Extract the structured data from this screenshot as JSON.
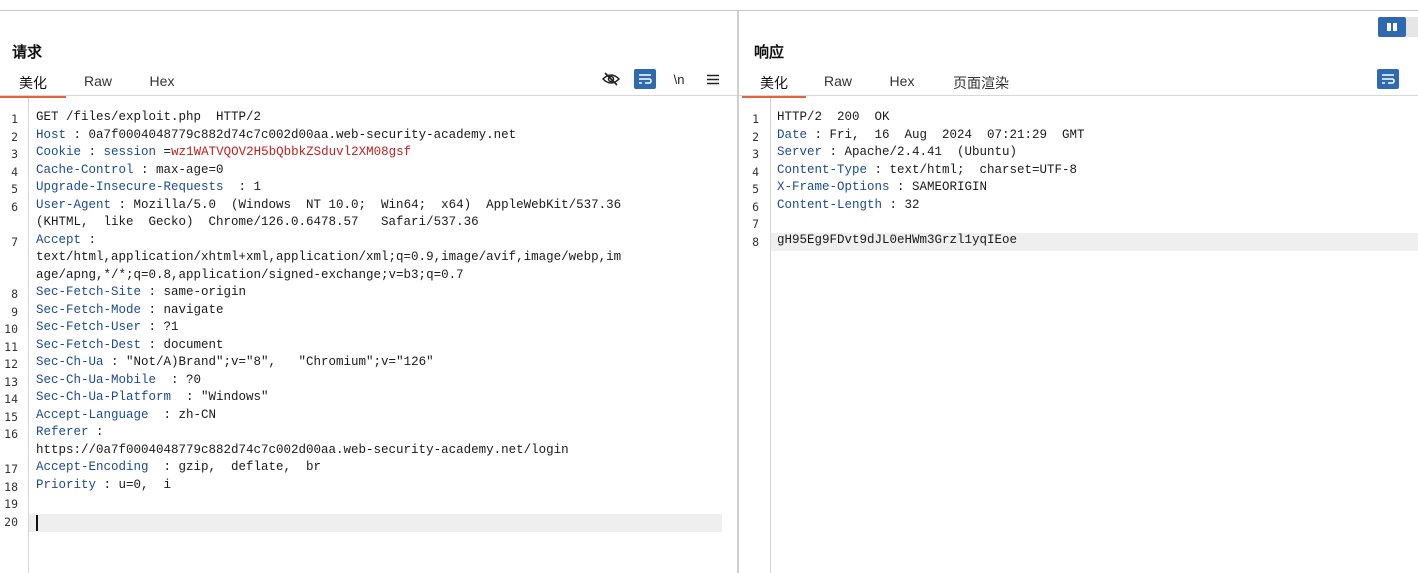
{
  "request": {
    "title": "请求",
    "tabs": [
      {
        "label": "美化",
        "active": true
      },
      {
        "label": "Raw",
        "active": false
      },
      {
        "label": "Hex",
        "active": false
      }
    ],
    "tools": {
      "hide": "eye-off-icon",
      "wrap": "wrap-icon",
      "newline": "\\n",
      "menu": "menu-icon"
    },
    "lines": [
      {
        "no": "1",
        "parts": [
          {
            "t": "GET /files/exploit.php  HTTP/2",
            "c": "v"
          }
        ]
      },
      {
        "no": "2",
        "parts": [
          {
            "t": "Host",
            "c": "k"
          },
          {
            "t": " : 0a7f0004048779c882d74c7c002d00aa.web-security-academy.net",
            "c": "v"
          }
        ]
      },
      {
        "no": "3",
        "parts": [
          {
            "t": "Cookie",
            "c": "k"
          },
          {
            "t": " : ",
            "c": "v"
          },
          {
            "t": "session",
            "c": "k"
          },
          {
            "t": " =",
            "c": "v"
          },
          {
            "t": "wz1WATVQOV2H5bQbbkZSduvl2XM08gsf",
            "c": "red"
          }
        ]
      },
      {
        "no": "4",
        "parts": [
          {
            "t": "Cache-Control",
            "c": "k"
          },
          {
            "t": " : max-age=0",
            "c": "v"
          }
        ]
      },
      {
        "no": "5",
        "parts": [
          {
            "t": "Upgrade-Insecure-Requests",
            "c": "k"
          },
          {
            "t": "  : 1",
            "c": "v"
          }
        ]
      },
      {
        "no": "6",
        "parts": [
          {
            "t": "User-Agent",
            "c": "k"
          },
          {
            "t": " : Mozilla/5.0  (Windows  NT 10.0;  Win64;  x64)  AppleWebKit/537.36",
            "c": "v"
          }
        ]
      },
      {
        "no": "",
        "parts": [
          {
            "t": "(KHTML,  like  Gecko)  Chrome/126.0.6478.57   Safari/537.36",
            "c": "v"
          }
        ]
      },
      {
        "no": "7",
        "parts": [
          {
            "t": "Accept",
            "c": "k"
          },
          {
            "t": " :",
            "c": "v"
          }
        ]
      },
      {
        "no": "",
        "parts": [
          {
            "t": "text/html,application/xhtml+xml,application/xml;q=0.9,image/avif,image/webp,im",
            "c": "v"
          }
        ]
      },
      {
        "no": "",
        "parts": [
          {
            "t": "age/apng,*/*;q=0.8,application/signed-exchange;v=b3;q=0.7",
            "c": "v"
          }
        ]
      },
      {
        "no": "8",
        "parts": [
          {
            "t": "Sec-Fetch-Site",
            "c": "k"
          },
          {
            "t": " : same-origin",
            "c": "v"
          }
        ]
      },
      {
        "no": "9",
        "parts": [
          {
            "t": "Sec-Fetch-Mode",
            "c": "k"
          },
          {
            "t": " : navigate",
            "c": "v"
          }
        ]
      },
      {
        "no": "10",
        "parts": [
          {
            "t": "Sec-Fetch-User",
            "c": "k"
          },
          {
            "t": " : ?1",
            "c": "v"
          }
        ]
      },
      {
        "no": "11",
        "parts": [
          {
            "t": "Sec-Fetch-Dest",
            "c": "k"
          },
          {
            "t": " : document",
            "c": "v"
          }
        ]
      },
      {
        "no": "12",
        "parts": [
          {
            "t": "Sec-Ch-Ua",
            "c": "k"
          },
          {
            "t": " : \"Not/A)Brand\";v=\"8\",   \"Chromium\";v=\"126\"",
            "c": "v"
          }
        ]
      },
      {
        "no": "13",
        "parts": [
          {
            "t": "Sec-Ch-Ua-Mobile",
            "c": "k"
          },
          {
            "t": "  : ?0",
            "c": "v"
          }
        ]
      },
      {
        "no": "14",
        "parts": [
          {
            "t": "Sec-Ch-Ua-Platform",
            "c": "k"
          },
          {
            "t": "  : \"Windows\"",
            "c": "v"
          }
        ]
      },
      {
        "no": "15",
        "parts": [
          {
            "t": "Accept-Language",
            "c": "k"
          },
          {
            "t": "  : zh-CN",
            "c": "v"
          }
        ]
      },
      {
        "no": "16",
        "parts": [
          {
            "t": "Referer",
            "c": "k"
          },
          {
            "t": " :",
            "c": "v"
          }
        ]
      },
      {
        "no": "",
        "parts": [
          {
            "t": "https://0a7f0004048779c882d74c7c002d00aa.web-security-academy.net/login",
            "c": "v"
          }
        ]
      },
      {
        "no": "17",
        "parts": [
          {
            "t": "Accept-Encoding",
            "c": "k"
          },
          {
            "t": "  : gzip,  deflate,  br",
            "c": "v"
          }
        ]
      },
      {
        "no": "18",
        "parts": [
          {
            "t": "Priority",
            "c": "k"
          },
          {
            "t": " : u=0,  i",
            "c": "v"
          }
        ]
      },
      {
        "no": "19",
        "parts": []
      },
      {
        "no": "20",
        "parts": []
      }
    ]
  },
  "response": {
    "title": "响应",
    "tabs": [
      {
        "label": "美化",
        "active": true
      },
      {
        "label": "Raw",
        "active": false
      },
      {
        "label": "Hex",
        "active": false
      },
      {
        "label": "页面渲染",
        "active": false
      }
    ],
    "tools": {
      "wrap": "wrap-icon"
    },
    "lines": [
      {
        "no": "1",
        "parts": [
          {
            "t": "HTTP/2  200  OK",
            "c": "v"
          }
        ]
      },
      {
        "no": "2",
        "parts": [
          {
            "t": "Date",
            "c": "k"
          },
          {
            "t": " : Fri,  16  Aug  2024  07:21:29  GMT",
            "c": "v"
          }
        ]
      },
      {
        "no": "3",
        "parts": [
          {
            "t": "Server",
            "c": "k"
          },
          {
            "t": " : Apache/2.4.41  (Ubuntu)",
            "c": "v"
          }
        ]
      },
      {
        "no": "4",
        "parts": [
          {
            "t": "Content-Type",
            "c": "k"
          },
          {
            "t": " : text/html;  charset=UTF-8",
            "c": "v"
          }
        ]
      },
      {
        "no": "5",
        "parts": [
          {
            "t": "X-Frame-Options",
            "c": "k"
          },
          {
            "t": " : SAMEORIGIN",
            "c": "v"
          }
        ]
      },
      {
        "no": "6",
        "parts": [
          {
            "t": "Content-Length",
            "c": "k"
          },
          {
            "t": " : 32",
            "c": "v"
          }
        ]
      },
      {
        "no": "7",
        "parts": []
      },
      {
        "no": "8",
        "parts": [
          {
            "t": "gH95Eg9FDvt9dJL0eHWm3Grzl1yqIEoe",
            "c": "v"
          }
        ]
      }
    ]
  },
  "colors": {
    "accent": "#e8613c",
    "key": "#1b4a93",
    "cookie_value": "#c01f1f",
    "toggle": "#2f6ab0"
  }
}
